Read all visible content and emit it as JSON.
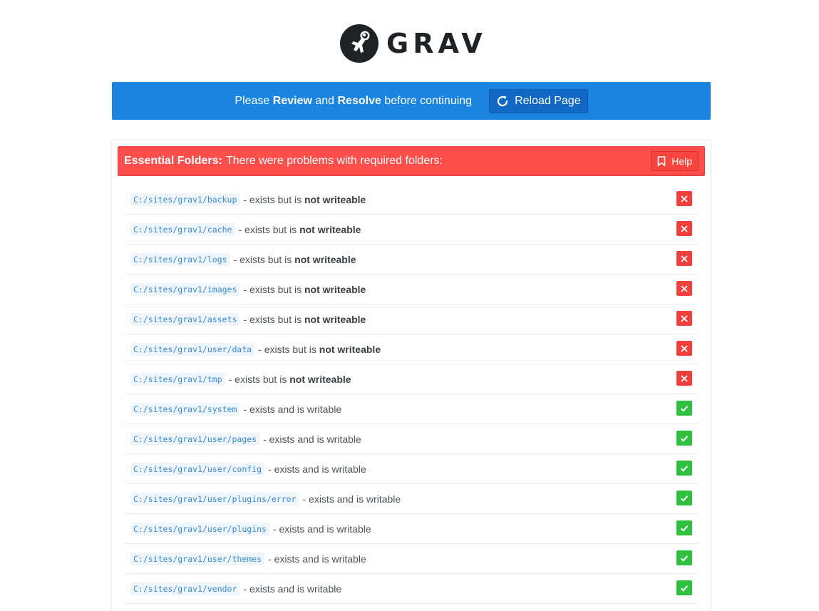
{
  "logo": {
    "wordmark": "GRAV",
    "icon": "astronaut-icon"
  },
  "banner": {
    "pre": "Please ",
    "review": "Review",
    "mid": " and ",
    "resolve": "Resolve",
    "post": " before continuing",
    "reload_label": "Reload Page",
    "reload_icon": "refresh-icon",
    "color": "#1b84e0"
  },
  "panel": {
    "title_bold": "Essential Folders:",
    "title_text": "There were problems with required folders:",
    "help_label": "Help",
    "help_icon": "bookmark-icon",
    "color": "#fe4e4b"
  },
  "rows": [
    {
      "path": "C:/sites/grav1/backup",
      "text": "- exists but is ",
      "bold": "not writeable",
      "status": "error"
    },
    {
      "path": "C:/sites/grav1/cache",
      "text": "- exists but is ",
      "bold": "not writeable",
      "status": "error"
    },
    {
      "path": "C:/sites/grav1/logs",
      "text": "- exists but is ",
      "bold": "not writeable",
      "status": "error"
    },
    {
      "path": "C:/sites/grav1/images",
      "text": "- exists but is ",
      "bold": "not writeable",
      "status": "error"
    },
    {
      "path": "C:/sites/grav1/assets",
      "text": "- exists but is ",
      "bold": "not writeable",
      "status": "error"
    },
    {
      "path": "C:/sites/grav1/user/data",
      "text": "- exists but is ",
      "bold": "not writeable",
      "status": "error"
    },
    {
      "path": "C:/sites/grav1/tmp",
      "text": "- exists but is ",
      "bold": "not writeable",
      "status": "error"
    },
    {
      "path": "C:/sites/grav1/system",
      "text": "- exists and is writable",
      "bold": "",
      "status": "ok"
    },
    {
      "path": "C:/sites/grav1/user/pages",
      "text": "- exists and is writable",
      "bold": "",
      "status": "ok"
    },
    {
      "path": "C:/sites/grav1/user/config",
      "text": "- exists and is writable",
      "bold": "",
      "status": "ok"
    },
    {
      "path": "C:/sites/grav1/user/plugins/error",
      "text": "- exists and is writable",
      "bold": "",
      "status": "ok"
    },
    {
      "path": "C:/sites/grav1/user/plugins",
      "text": "- exists and is writable",
      "bold": "",
      "status": "ok"
    },
    {
      "path": "C:/sites/grav1/user/themes",
      "text": "- exists and is writable",
      "bold": "",
      "status": "ok"
    },
    {
      "path": "C:/sites/grav1/vendor",
      "text": "- exists and is writable",
      "bold": "",
      "status": "ok"
    }
  ],
  "status_colors": {
    "error": "#f1403c",
    "ok": "#2fc040"
  }
}
